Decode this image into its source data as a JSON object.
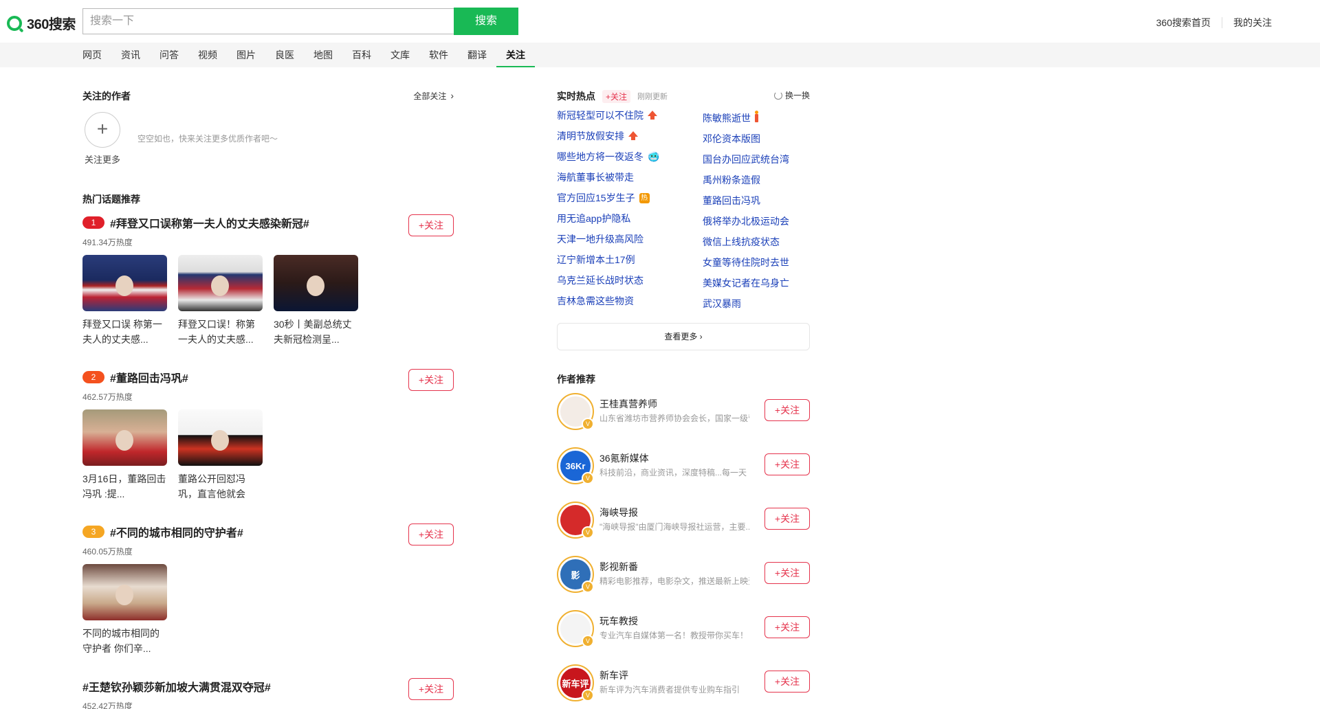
{
  "header": {
    "logo_text": "360搜索",
    "search_placeholder": "搜索一下",
    "search_button": "搜索",
    "links": [
      "360搜索首页",
      "我的关注"
    ]
  },
  "nav": {
    "items": [
      "网页",
      "资讯",
      "问答",
      "视频",
      "图片",
      "良医",
      "地图",
      "百科",
      "文库",
      "软件",
      "翻译",
      "关注"
    ],
    "active": "关注"
  },
  "followed_authors": {
    "title": "关注的作者",
    "follow_all": "全部关注",
    "plus": "+",
    "follow_more": "关注更多",
    "empty_text": "空空如也，快来关注更多优质作者吧～"
  },
  "hot_topics": {
    "title": "热门话题推荐",
    "follow_label": "+关注",
    "items": [
      {
        "rank": "1",
        "rank_color": "#e0202a",
        "title": "#拜登又口误称第一夫人的丈夫感染新冠#",
        "heat": "491.34万热度",
        "thumbs": [
          {
            "caption_1": "拜登又口误 称第一",
            "caption_2": "夫人的丈夫感..."
          },
          {
            "caption_1": "拜登又口误！称第",
            "caption_2": "一夫人的丈夫感..."
          },
          {
            "caption_1": "30秒丨美副总统丈",
            "caption_2": "夫新冠检测呈..."
          }
        ]
      },
      {
        "rank": "2",
        "rank_color": "#f4511e",
        "title": "#董路回击冯巩#",
        "heat": "462.57万热度",
        "thumbs": [
          {
            "caption_1": "3月16日，董路回击",
            "caption_2": "冯巩 :提..."
          },
          {
            "caption_1": "董路公开回怼冯",
            "caption_2": "巩，直言他就会"
          }
        ]
      },
      {
        "rank": "3",
        "rank_color": "#f5a623",
        "title": "#不同的城市相同的守护者#",
        "heat": "460.05万热度",
        "thumbs": [
          {
            "caption_1": "不同的城市相同的",
            "caption_2": "守护者 你们辛..."
          }
        ]
      },
      {
        "rank": "",
        "rank_color": "",
        "title": "#王楚钦孙颖莎新加坡大满贯混双夺冠#",
        "heat": "452.42万热度",
        "thumbs": []
      }
    ]
  },
  "realtime": {
    "title": "实时热点",
    "follow": "+关注",
    "updated": "刚刚更新",
    "refresh": "换一换",
    "left_col": [
      {
        "text": "新冠轻型可以不住院",
        "badge": "up"
      },
      {
        "text": "清明节放假安排",
        "badge": "up"
      },
      {
        "text": "哪些地方将一夜返冬",
        "badge": "emoji"
      },
      {
        "text": "海航董事长被带走",
        "badge": ""
      },
      {
        "text": "官方回应15岁生子",
        "badge": "hot"
      },
      {
        "text": "用无追app护隐私",
        "badge": ""
      },
      {
        "text": "天津一地升级高风险",
        "badge": ""
      },
      {
        "text": "辽宁新增本土17例",
        "badge": ""
      },
      {
        "text": "乌克兰延长战时状态",
        "badge": ""
      },
      {
        "text": "吉林急需这些物资",
        "badge": ""
      }
    ],
    "right_col": [
      {
        "text": "陈敏熊逝世",
        "badge": "candle"
      },
      {
        "text": "邓伦资本版图",
        "badge": ""
      },
      {
        "text": "国台办回应武统台湾",
        "badge": ""
      },
      {
        "text": "禹州粉条造假",
        "badge": ""
      },
      {
        "text": "董路回击冯巩",
        "badge": ""
      },
      {
        "text": "俄将举办北极运动会",
        "badge": ""
      },
      {
        "text": "微信上线抗疫状态",
        "badge": ""
      },
      {
        "text": "女童等待住院时去世",
        "badge": ""
      },
      {
        "text": "美媒女记者在乌身亡",
        "badge": ""
      },
      {
        "text": "武汉暴雨",
        "badge": ""
      }
    ],
    "hot_badge_text": "热",
    "emoji": "🥶",
    "view_more": "查看更多 ›"
  },
  "authors": {
    "title": "作者推荐",
    "follow_label": "+关注",
    "items": [
      {
        "name": "王桂真营养师",
        "desc": "山东省潍坊市营养师协会会长，国家一级营养师",
        "avatar_color": "#f3ece6",
        "avatar_text": ""
      },
      {
        "name": "36氪新媒体",
        "desc": "科技前沿，商业资讯，深度特稿...每一天",
        "avatar_color": "#1a66d6",
        "avatar_text": "36Kr"
      },
      {
        "name": "海峡导报",
        "desc": "\"海峡导报\"由厦门海峡导报社运营，主要...",
        "avatar_color": "#d52a2a",
        "avatar_text": ""
      },
      {
        "name": "影视新番",
        "desc": "精彩电影推荐，电影杂文，推送最新上映资讯",
        "avatar_color": "#2f6fb8",
        "avatar_text": "影"
      },
      {
        "name": "玩车教授",
        "desc": "专业汽车自媒体第一名！教授带你买车！",
        "avatar_color": "#f4f4f4",
        "avatar_text": ""
      },
      {
        "name": "新车评",
        "desc": "新车评为汽车消费者提供专业购车指引",
        "avatar_color": "#c8161d",
        "avatar_text": "新车评"
      }
    ]
  }
}
